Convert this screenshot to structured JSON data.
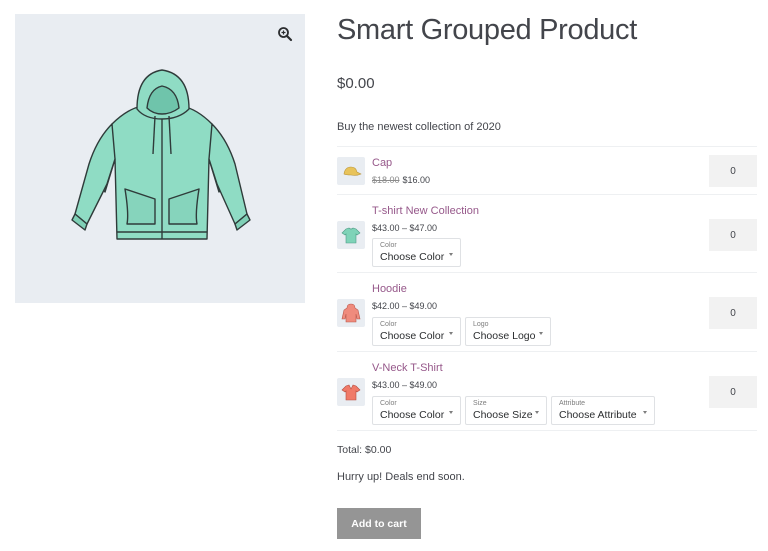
{
  "product": {
    "title": "Smart Grouped Product",
    "price": "$0.00",
    "description": "Buy the newest collection of 2020",
    "image_icon": "hoodie-image",
    "zoom_icon": "zoom-icon"
  },
  "items": [
    {
      "name": "Cap",
      "old_price": "$18.00",
      "price": "$16.00",
      "qty": "0",
      "thumb_color": "#e8c35a"
    },
    {
      "name": "T-shirt New Collection",
      "price": "$43.00 – $47.00",
      "qty": "0",
      "thumb_color": "#7fd3b8",
      "options": [
        {
          "label": "Color",
          "value": "Choose Color"
        }
      ]
    },
    {
      "name": "Hoodie",
      "price": "$42.00 – $49.00",
      "qty": "0",
      "thumb_color": "#ef8b7d",
      "options": [
        {
          "label": "Color",
          "value": "Choose Color"
        },
        {
          "label": "Logo",
          "value": "Choose Logo"
        }
      ]
    },
    {
      "name": "V-Neck T-Shirt",
      "price": "$43.00 – $49.00",
      "qty": "0",
      "thumb_color": "#f07a68",
      "options": [
        {
          "label": "Color",
          "value": "Choose Color"
        },
        {
          "label": "Size",
          "value": "Choose Size"
        },
        {
          "label": "Attribute",
          "value": "Choose Attribute"
        }
      ]
    }
  ],
  "summary": {
    "total": "Total: $0.00",
    "notice": "Hurry up! Deals end soon.",
    "add_to_cart": "Add to cart"
  },
  "colors": {
    "link": "#96588a",
    "button": "#959595",
    "image_bg": "#e9edf2"
  }
}
